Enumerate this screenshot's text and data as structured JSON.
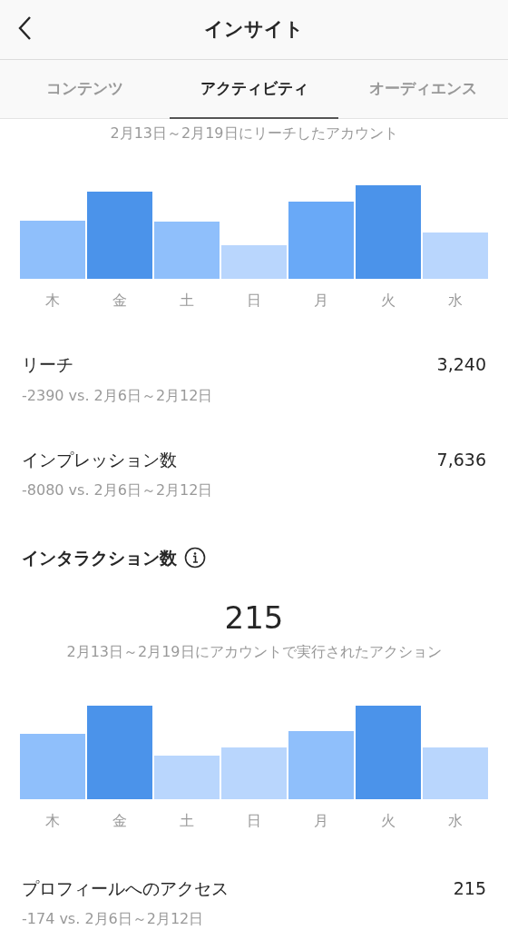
{
  "header": {
    "title": "インサイト"
  },
  "tabs": [
    {
      "label": "コンテンツ",
      "selected": false
    },
    {
      "label": "アクティビティ",
      "selected": true
    },
    {
      "label": "オーディエンス",
      "selected": false
    }
  ],
  "reach_chart": {
    "caption": "2月13日～2月19日にリーチしたアカウント",
    "day_labels": [
      "木",
      "金",
      "土",
      "日",
      "月",
      "火",
      "水"
    ]
  },
  "metrics": [
    {
      "label": "リーチ",
      "value": "3,240",
      "comparison": "-2390 vs. 2月6日～2月12日"
    },
    {
      "label": "インプレッション数",
      "value": "7,636",
      "comparison": "-8080 vs. 2月6日～2月12日"
    }
  ],
  "interactions": {
    "heading": "インタラクション数",
    "total": "215",
    "caption": "2月13日～2月19日にアカウントで実行されたアクション",
    "day_labels": [
      "木",
      "金",
      "土",
      "日",
      "月",
      "火",
      "水"
    ]
  },
  "interaction_metrics": [
    {
      "label": "プロフィールへのアクセス",
      "value": "215",
      "comparison": "-174 vs. 2月6日～2月12日"
    }
  ]
}
